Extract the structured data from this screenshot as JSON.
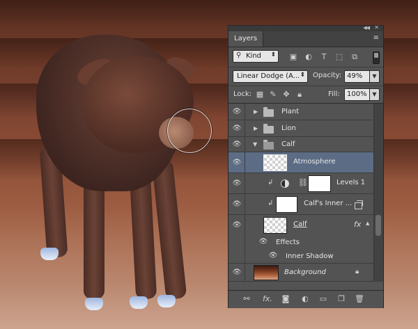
{
  "panel": {
    "tab_label": "Layers",
    "menu_icon": "panel-menu-icon",
    "filter": {
      "kind_label": "Kind",
      "icons": [
        "pixel-filter-icon",
        "adjustment-filter-icon",
        "type-filter-icon",
        "shape-filter-icon",
        "smart-object-filter-icon"
      ]
    },
    "blend_mode": "Linear Dodge (A...",
    "opacity_label": "Opacity:",
    "opacity_value": "49%",
    "lock_label": "Lock:",
    "fill_label": "Fill:",
    "fill_value": "100%",
    "layers": [
      {
        "name": "Plant",
        "type": "group",
        "expanded": false
      },
      {
        "name": "Lion",
        "type": "group",
        "expanded": false
      },
      {
        "name": "Calf",
        "type": "group",
        "expanded": true
      },
      {
        "name": "Atmosphere",
        "type": "layer",
        "selected": true
      },
      {
        "name": "Levels 1",
        "type": "adjustment",
        "clipped": true
      },
      {
        "name": "Calf's Inner ...",
        "type": "smart-object",
        "clipped": true
      },
      {
        "name": "Calf",
        "type": "layer",
        "has_fx": true
      },
      {
        "name": "Effects",
        "type": "effects-header"
      },
      {
        "name": "Inner Shadow",
        "type": "effect"
      },
      {
        "name": "Background",
        "type": "background",
        "locked": true
      }
    ],
    "fx_label": "fx",
    "bottom_icons": [
      "link-layers-icon",
      "add-style-icon",
      "add-mask-icon",
      "new-adjustment-icon",
      "new-group-icon",
      "new-layer-icon",
      "delete-layer-icon"
    ],
    "bottom_fx_label": "fx."
  },
  "colors": {
    "panel_bg": "#535353",
    "selected_row": "#5c6c85"
  }
}
